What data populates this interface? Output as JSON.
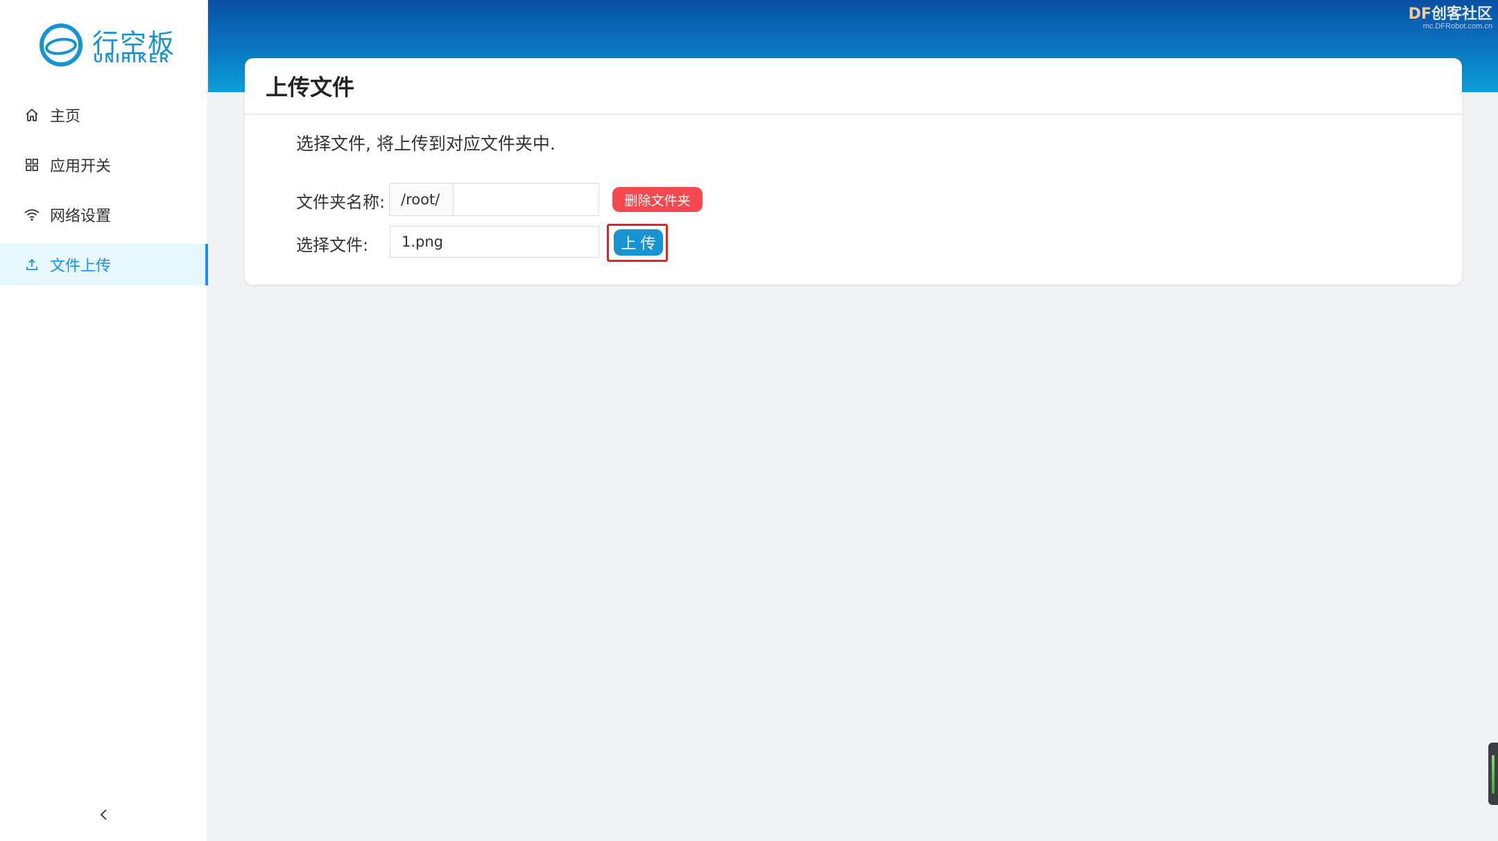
{
  "brand": {
    "name_cn": "行空板",
    "name_en": "UNIHIKER",
    "accent": "#1793d1"
  },
  "sidebar": {
    "items": [
      {
        "label": "主页",
        "icon": "home-icon",
        "active": false
      },
      {
        "label": "应用开关",
        "icon": "grid-icon",
        "active": false
      },
      {
        "label": "网络设置",
        "icon": "wifi-icon",
        "active": false
      },
      {
        "label": "文件上传",
        "icon": "upload-icon",
        "active": true
      }
    ],
    "collapse_icon": "chevron-left-icon"
  },
  "card": {
    "title": "上传文件",
    "hint": "选择文件, 将上传到对应文件夹中.",
    "folder": {
      "label": "文件夹名称:",
      "prefix": "/root/",
      "value": "",
      "delete_label": "删除文件夹"
    },
    "file": {
      "label": "选择文件:",
      "value": "1.png",
      "upload_label": "上传"
    }
  },
  "watermark": {
    "main_prefix": "DF",
    "main_rest": "创客社区",
    "sub": "mc.DFRobot.com.cn"
  },
  "colors": {
    "danger": "#f5484f",
    "primary": "#1793d1",
    "highlight": "#e82020",
    "active_nav": "#1890ff"
  }
}
